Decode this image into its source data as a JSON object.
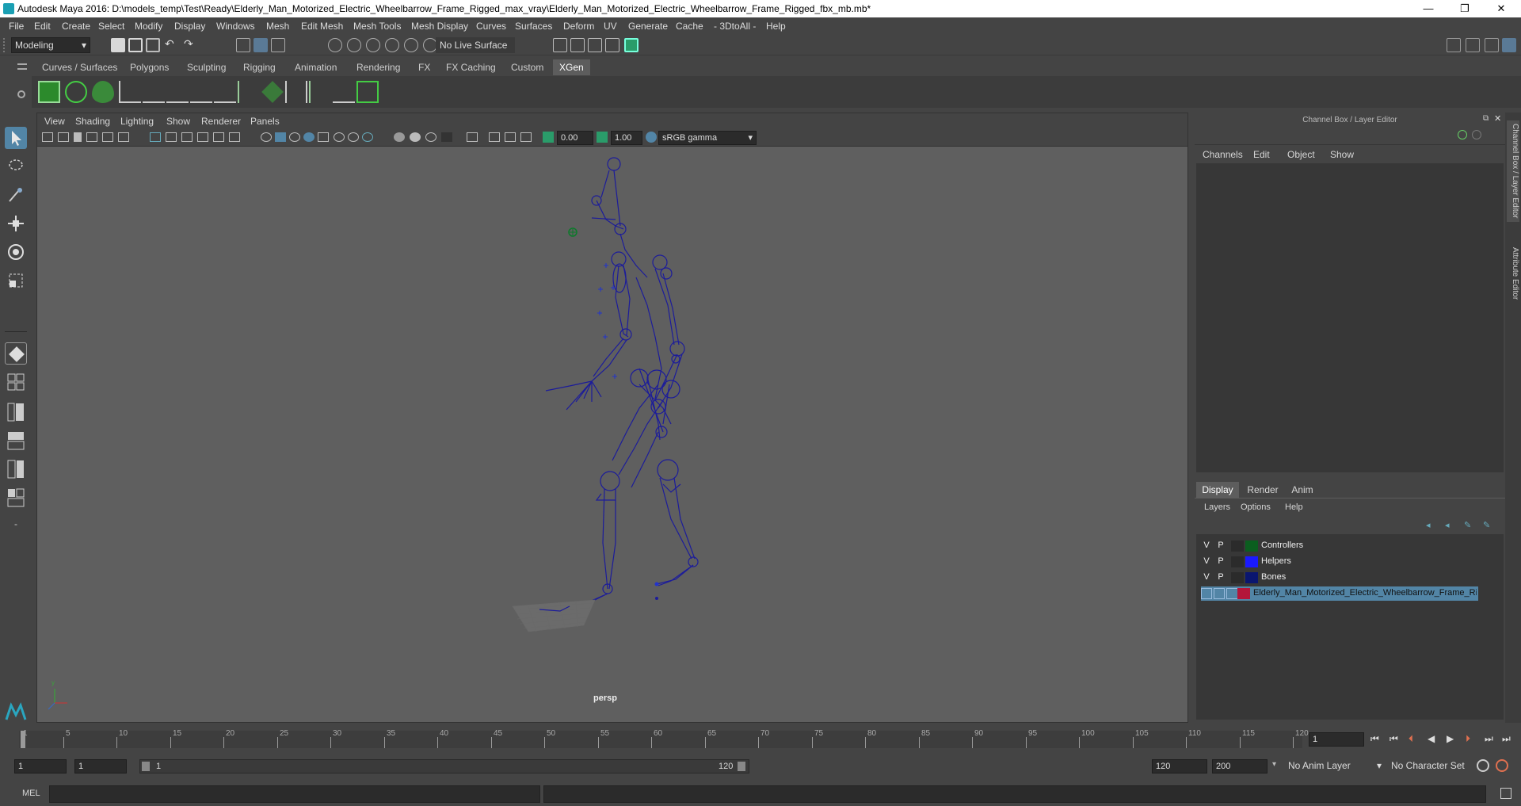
{
  "window": {
    "title": "Autodesk Maya 2016: D:\\models_temp\\Test\\Ready\\Elderly_Man_Motorized_Electric_Wheelbarrow_Frame_Rigged_max_vray\\Elderly_Man_Motorized_Electric_Wheelbarrow_Frame_Rigged_fbx_mb.mb*",
    "minimize": "—",
    "restore": "❐",
    "close": "✕"
  },
  "menubar": [
    "File",
    "Edit",
    "Create",
    "Select",
    "Modify",
    "Display",
    "Windows",
    "Mesh",
    "Edit Mesh",
    "Mesh Tools",
    "Mesh Display",
    "Curves",
    "Surfaces",
    "Deform",
    "UV",
    "Generate",
    "Cache",
    "- 3DtoAll -",
    "Help"
  ],
  "statusline": {
    "mode": "Modeling",
    "live_surface": "No Live Surface"
  },
  "shelf_tabs": [
    "Curves / Surfaces",
    "Polygons",
    "Sculpting",
    "Rigging",
    "Animation",
    "Rendering",
    "FX",
    "FX Caching",
    "Custom",
    "XGen"
  ],
  "viewport": {
    "menu": [
      "View",
      "Shading",
      "Lighting",
      "Show",
      "Renderer",
      "Panels"
    ],
    "exposure": "0.00",
    "gamma": "1.00",
    "colorspace": "sRGB gamma",
    "camera_label": "persp"
  },
  "channel_box": {
    "title": "Channel Box / Layer Editor",
    "menu": [
      "Channels",
      "Edit",
      "Object",
      "Show"
    ]
  },
  "layer_editor": {
    "tabs": [
      "Display",
      "Render",
      "Anim"
    ],
    "menu": [
      "Layers",
      "Options",
      "Help"
    ],
    "layers": [
      {
        "v": "V",
        "p": "P",
        "color": "#0b5e1f",
        "name": "Controllers"
      },
      {
        "v": "V",
        "p": "P",
        "color": "#1a1aff",
        "name": "Helpers"
      },
      {
        "v": "V",
        "p": "P",
        "color": "#0a1670",
        "name": "Bones"
      },
      {
        "v": "",
        "p": "",
        "color": "#b3163a",
        "name": "Elderly_Man_Motorized_Electric_Wheelbarrow_Frame_Ri"
      }
    ]
  },
  "side_tabs": [
    "Channel Box / Layer Editor",
    "Attribute Editor"
  ],
  "timeline": {
    "ticks": [
      "1",
      "5",
      "10",
      "15",
      "20",
      "25",
      "30",
      "35",
      "40",
      "45",
      "50",
      "55",
      "60",
      "65",
      "70",
      "75",
      "80",
      "85",
      "90",
      "95",
      "100",
      "105",
      "110",
      "115",
      "120"
    ],
    "current_frame": "1"
  },
  "range": {
    "start": "1",
    "start2": "1",
    "slider_start": "1",
    "slider_end": "120",
    "end": "120",
    "end2": "200",
    "anim_layer": "No Anim Layer",
    "char_set": "No Character Set"
  },
  "cmdline": {
    "label": "MEL"
  },
  "colors": {
    "bone": "#1c1c9a",
    "accent": "#5285a6"
  }
}
